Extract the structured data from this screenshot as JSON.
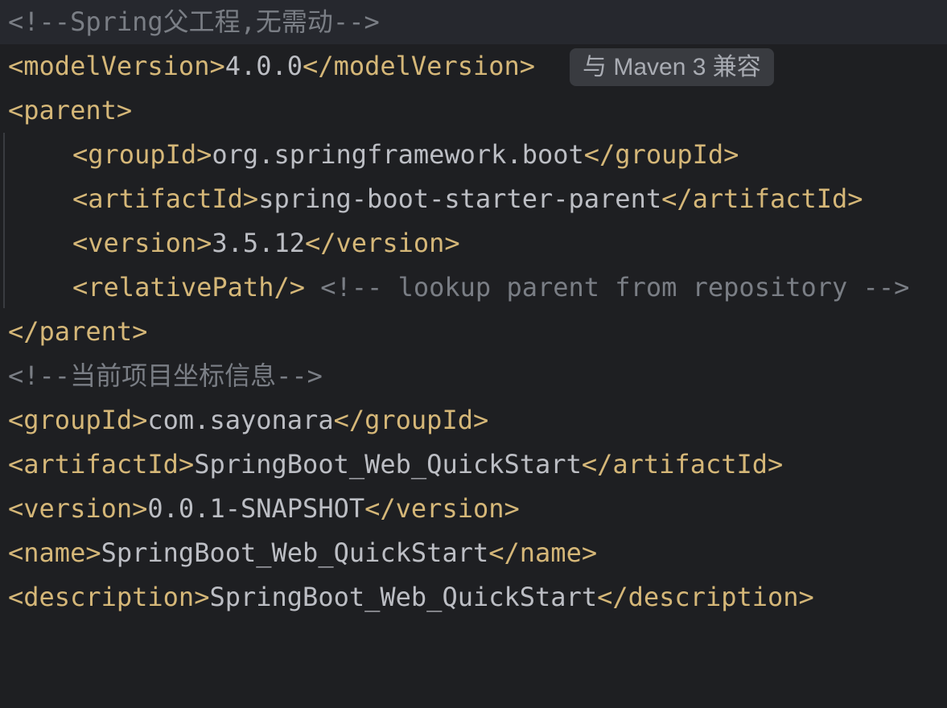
{
  "editor": {
    "lines": [
      {
        "comment": "<!--Spring父工程,无需动-->"
      },
      {
        "open": "<modelVersion>",
        "text": "4.0.0",
        "close": "</modelVersion>",
        "hint": "与 Maven 3 兼容"
      },
      {
        "open": "<parent>"
      },
      {
        "open": "<groupId>",
        "text": "org.springframework.boot",
        "close": "</groupId>"
      },
      {
        "open": "<artifactId>",
        "text": "spring-boot-starter-parent",
        "close": "</artifactId>"
      },
      {
        "open": "<version>",
        "text": "3.5.12",
        "close": "</version>"
      },
      {
        "open": "<relativePath/>",
        "comment": " <!-- lookup parent from repository -->"
      },
      {
        "open": "</parent>"
      },
      {
        "comment": "<!--当前项目坐标信息-->"
      },
      {
        "open": "<groupId>",
        "text": "com.sayonara",
        "close": "</groupId>"
      },
      {
        "open": "<artifactId>",
        "text": "SpringBoot_Web_QuickStart",
        "close": "</artifactId>"
      },
      {
        "open": "<version>",
        "text": "0.0.1-SNAPSHOT",
        "close": "</version>"
      },
      {
        "open": "<name>",
        "text": "SpringBoot_Web_QuickStart",
        "close": "</name>"
      },
      {
        "open": "<description>",
        "text": "SpringBoot_Web_QuickStart",
        "close": "</description>"
      }
    ]
  },
  "colors": {
    "background": "#1e1f22",
    "current_line": "#26282e",
    "tag": "#d5b778",
    "text": "#bcbec4",
    "comment": "#7a7e85",
    "hint_background": "#393b40"
  }
}
